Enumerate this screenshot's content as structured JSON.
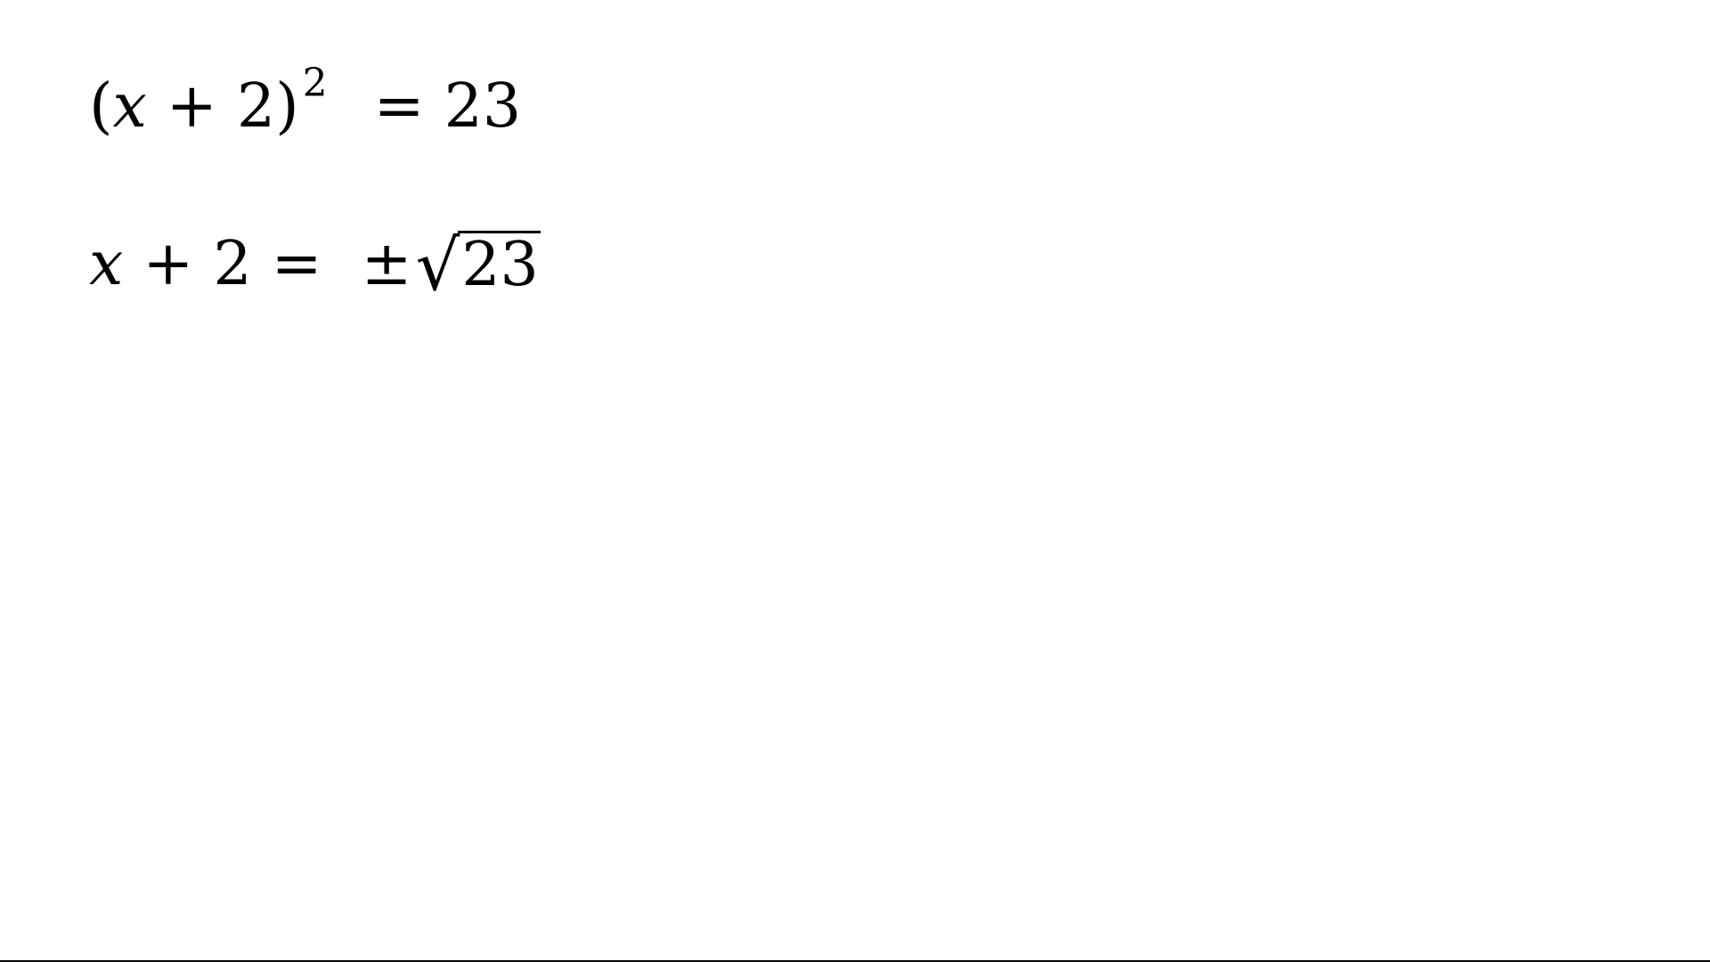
{
  "equations": [
    {
      "open_paren": "(",
      "var": "x",
      "plus": "+",
      "two": "2",
      "close_paren": ")",
      "exponent": "2",
      "equals": "=",
      "rhs": "23"
    },
    {
      "var": "x",
      "plus": "+",
      "two": "2",
      "equals": "=",
      "plus_minus": "±",
      "radical": "√",
      "radicand": "23"
    }
  ],
  "colors": {
    "background": "#ffffff",
    "text": "#000000"
  }
}
